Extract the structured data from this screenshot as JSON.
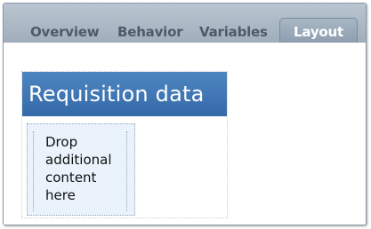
{
  "tabs": [
    {
      "label": "Overview",
      "active": false
    },
    {
      "label": "Behavior",
      "active": false
    },
    {
      "label": "Variables",
      "active": false
    },
    {
      "label": "Layout",
      "active": true
    }
  ],
  "section": {
    "title": "Requisition data",
    "dropzone_lines": [
      "Drop",
      "additional",
      "content",
      "here"
    ]
  },
  "colors": {
    "tabbar": "#9fadbb",
    "tab_text": "#4e5a6a",
    "active_tab": "#8c9cad",
    "header_blue": "#3569a8",
    "dropzone_bg": "#eaf3fc"
  }
}
